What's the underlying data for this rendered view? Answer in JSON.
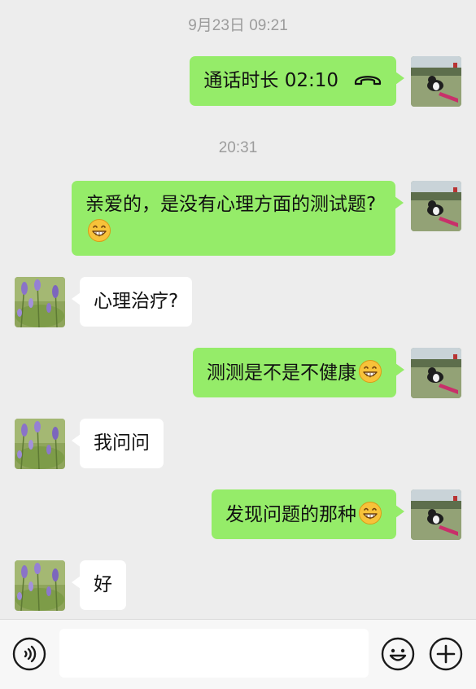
{
  "timestamps": {
    "first": "9月23日 09:21",
    "second": "20:31"
  },
  "messages": [
    {
      "side": "me",
      "text": "通话时长 02:10",
      "icon": "hang-up-call-icon"
    },
    {
      "side": "me",
      "text": "亲爱的，是没有心理方面的测试题?",
      "emoji": "grinning-face-emoji"
    },
    {
      "side": "them",
      "text": "心理治疗?"
    },
    {
      "side": "me",
      "text": "测测是不是不健康",
      "emoji": "grinning-face-emoji"
    },
    {
      "side": "them",
      "text": "我问问"
    },
    {
      "side": "me",
      "text": "发现问题的那种",
      "emoji": "grinning-face-emoji"
    },
    {
      "side": "them",
      "text": "好"
    }
  ],
  "avatars": {
    "me": "dog-on-grass-photo",
    "them": "lavender-flowers-photo"
  },
  "input_bar": {
    "left_icon": "voice-input-icon",
    "text_value": "",
    "emoji_icon": "emoji-sticker-icon",
    "more_icon": "plus-more-icon"
  },
  "colors": {
    "background": "#ededed",
    "my_bubble": "#95ec69",
    "their_bubble": "#ffffff",
    "timestamp": "#9c9c9c"
  }
}
